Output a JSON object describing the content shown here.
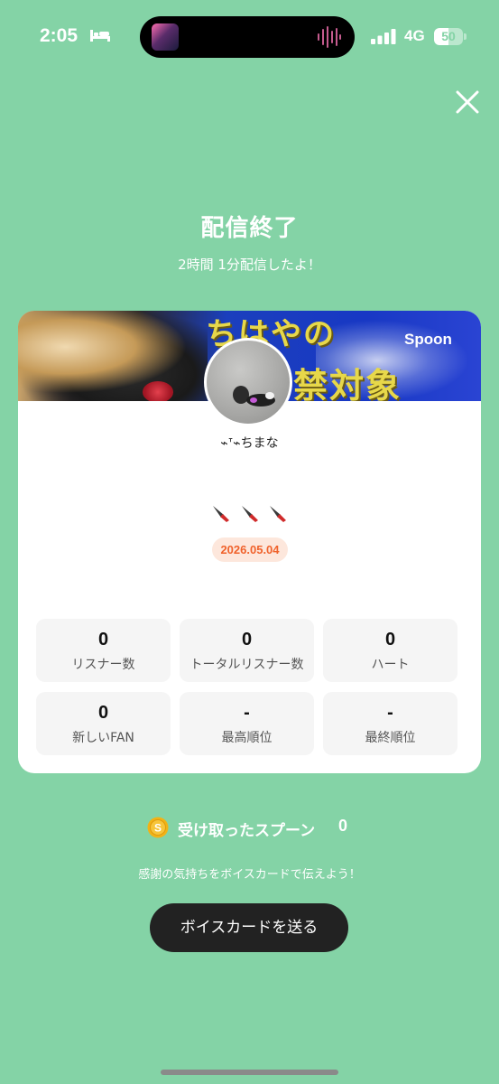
{
  "status_bar": {
    "time": "2:05",
    "network": "4G",
    "battery_percent": "50",
    "battery_level": 0.5,
    "icons": [
      "bed-icon",
      "audio-wave-icon",
      "signal-icon",
      "battery-icon"
    ]
  },
  "header": {
    "close_icon": "close-icon",
    "title": "配信終了",
    "subtitle": "2時間 1分配信したよ！"
  },
  "card": {
    "banner": {
      "text_line_1": "ちはやの",
      "text_line_2": "禁対象",
      "brand": "Spoon"
    },
    "username": "⌁ᐪ⌁ちまな",
    "emoji_icons": [
      "knife-icon",
      "knife-icon",
      "knife-icon"
    ],
    "date": "2026.05.04",
    "stats": [
      {
        "value": "0",
        "label": "リスナー数"
      },
      {
        "value": "0",
        "label": "トータルリスナー数"
      },
      {
        "value": "0",
        "label": "ハート"
      },
      {
        "value": "0",
        "label": "新しいFAN"
      },
      {
        "value": "-",
        "label": "最高順位"
      },
      {
        "value": "-",
        "label": "最終順位"
      }
    ]
  },
  "received": {
    "icon": "spoon-coin-icon",
    "coin_letter": "S",
    "label": "受け取ったスプーン",
    "count": "0"
  },
  "thanks_text": "感謝の気持ちをボイスカードで伝えよう！",
  "voice_card_button": "ボイスカードを送る",
  "colors": {
    "background": "#84d3a6",
    "button": "#222222",
    "date_badge_text": "#f0622b",
    "date_badge_bg": "#fde7dc",
    "coin": "#f2b316"
  }
}
